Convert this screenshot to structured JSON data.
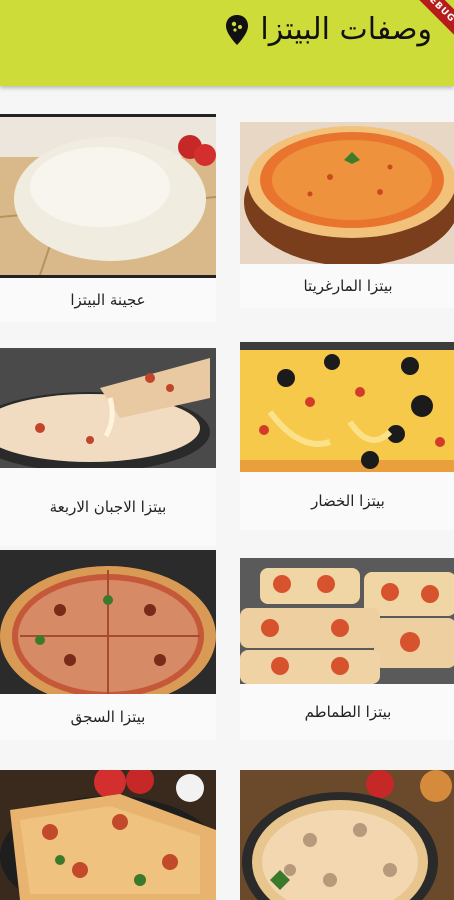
{
  "appbar": {
    "title": "وصفات البيتزا",
    "pin_icon": "map-pin-icon",
    "debug_banner": "DEBUG"
  },
  "colors": {
    "appbar": "#cddc39",
    "background": "#f6f6f6",
    "debug": "#b71c1c"
  },
  "recipes": [
    {
      "label": "بيتزا المارغريتا",
      "image": "pizza-margherita-photo"
    },
    {
      "label": "عجينة البيتزا",
      "image": "pizza-dough-photo"
    },
    {
      "label": "بيتزا الخضار",
      "image": "vegetable-pizza-photo"
    },
    {
      "label": "بيتزا الاجبان الاربعة",
      "image": "four-cheese-pizza-photo"
    },
    {
      "label": "بيتزا الطماطم",
      "image": "tomato-pizza-photo"
    },
    {
      "label": "بيتزا السجق",
      "image": "sausage-pizza-photo"
    },
    {
      "label": "",
      "image": "mushroom-pizza-photo"
    },
    {
      "label": "",
      "image": "pepperoni-pizza-photo"
    }
  ]
}
